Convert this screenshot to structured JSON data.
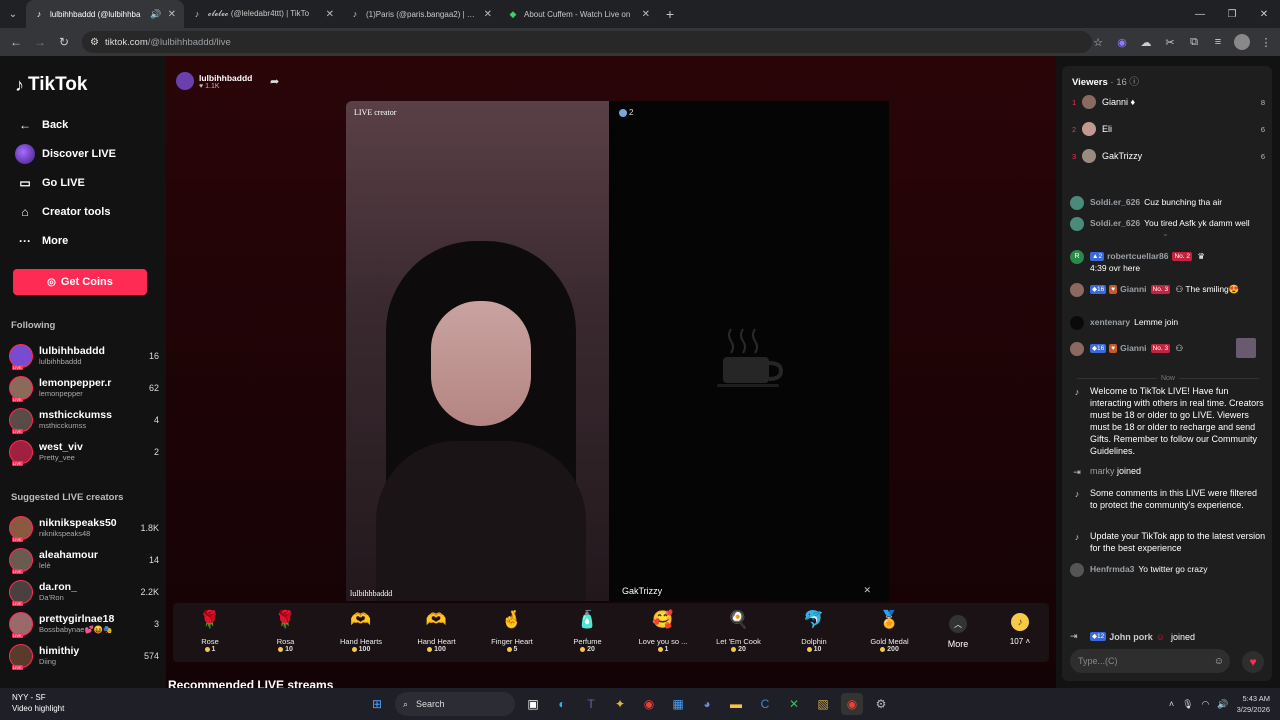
{
  "browser": {
    "tabs": [
      {
        "title": "lulbihhbaddd (@lulbihhba",
        "active": true
      },
      {
        "title": "𝓸𝓵𝓮𝓵𝓮𝓸 (@leledabr4ttt) | TikTo",
        "active": false
      },
      {
        "title": "(1)Paris (@paris.bangaa2) | TikT",
        "active": false
      },
      {
        "title": "About Cuffem - Watch Live on",
        "active": false
      }
    ],
    "url_host": "tiktok.com",
    "url_path": "/@lulbihhbaddd/live"
  },
  "sidebar": {
    "logo_text": "TikTok",
    "back_label": "Back",
    "nav": [
      {
        "label": "Discover LIVE",
        "icon": "discover-live-icon"
      },
      {
        "label": "Go LIVE",
        "icon": "video-camera-icon"
      },
      {
        "label": "Creator tools",
        "icon": "home-icon"
      },
      {
        "label": "More",
        "icon": "ellipsis-icon"
      }
    ],
    "get_coins_label": "Get Coins",
    "following_title": "Following",
    "following": [
      {
        "name": "lulbihhbaddd",
        "sub": "lulbihhbaddd",
        "count": "16",
        "color": "#7a4bd0"
      },
      {
        "name": "lemonpepper.r",
        "sub": "lemonpepper",
        "count": "62",
        "color": "#8a6a58"
      },
      {
        "name": "msthicckumss",
        "sub": "msthicckumss",
        "count": "4",
        "color": "#5a4a48"
      },
      {
        "name": "west_viv",
        "sub": "Pretty_vee",
        "count": "2",
        "color": "#a02040"
      }
    ],
    "suggested_title": "Suggested LIVE creators",
    "suggested": [
      {
        "name": "niknikspeaks50",
        "sub": "niknikspeaks48",
        "count": "1.8K",
        "color": "#8a5a40"
      },
      {
        "name": "aleahamour",
        "sub": "lelè",
        "count": "14",
        "color": "#6a5a50"
      },
      {
        "name": "da.ron_",
        "sub": "Da'Ron",
        "count": "2.2K",
        "color": "#4a4040"
      },
      {
        "name": "prettygirlnae18",
        "sub": "Bossbabynae💕😝🎭",
        "count": "3",
        "color": "#9a6a6a"
      },
      {
        "name": "himithiy",
        "sub": "Diing",
        "count": "574",
        "color": "#5a3a2a"
      }
    ]
  },
  "stream": {
    "host_name": "lulbihhbaddd",
    "host_likes": "1.1K",
    "live_creator_label": "LIVE creator",
    "host_video_name": "lulbihhbaddd",
    "guest_count": "2",
    "guest_name": "GakTrizzy",
    "recommended_title": "Recommended LIVE streams"
  },
  "gifts": [
    {
      "name": "Rose",
      "price": "1",
      "icon": "🌹"
    },
    {
      "name": "Rosa",
      "price": "10",
      "icon": "🌹"
    },
    {
      "name": "Hand Hearts",
      "price": "100",
      "icon": "🫶"
    },
    {
      "name": "Hand Heart",
      "price": "100",
      "icon": "🫶"
    },
    {
      "name": "Finger Heart",
      "price": "5",
      "icon": "🤞"
    },
    {
      "name": "Perfume",
      "price": "20",
      "icon": "🧴"
    },
    {
      "name": "Love you so ...",
      "price": "1",
      "icon": "🥰"
    },
    {
      "name": "Let 'Em Cook",
      "price": "20",
      "icon": "🍳"
    },
    {
      "name": "Dolphin",
      "price": "10",
      "icon": "🐬"
    },
    {
      "name": "Gold Medal",
      "price": "200",
      "icon": "🏅"
    }
  ],
  "gift_more_label": "More",
  "coin_balance": "107",
  "chat": {
    "viewers_label": "Viewers",
    "viewers_count": "16",
    "top_viewers": [
      {
        "rank": "1",
        "name": "Gianni ♦",
        "count": "8",
        "color": "#8a6a60"
      },
      {
        "rank": "2",
        "name": "Eli",
        "count": "6",
        "color": "#c09a90"
      },
      {
        "rank": "3",
        "name": "GakTrizzy",
        "count": "6",
        "color": "#9a8a80"
      }
    ],
    "messages": [
      {
        "user": "Soldi.er_626",
        "text": "Cuz bunching tha air"
      },
      {
        "user": "Soldi.er_626",
        "text": "You tired Asfk yk damm well"
      },
      {
        "user": "robertcuellar86",
        "text": "4:39 ovr here"
      },
      {
        "user": "Gianni",
        "text": "The smiling😍"
      },
      {
        "user": "xentenary",
        "text": "Lemme join"
      },
      {
        "user": "Gianni",
        "text": ""
      }
    ],
    "badges": {
      "lvl_2": "2",
      "lvl_16": "16",
      "no_2": "No. 2",
      "no_3": "No. 3",
      "lvl_12": "12"
    },
    "now_label": "Now",
    "welcome": "Welcome to TikTok LIVE! Have fun interacting with others in real time. Creators must be 18 or older to go LIVE. Viewers must be 18 or older to recharge and send Gifts. Remember to follow our Community Guidelines.",
    "joined_user_1": "marky",
    "joined_text": "joined",
    "filtered_notice": "Some comments in this LIVE were filtered to protect the community's experience.",
    "update_notice": "Update your TikTok app to the latest version for the best experience",
    "last_user": "Henfrmda3",
    "last_text": "Yo twitter go crazy",
    "joined_user_2": "John pork",
    "input_placeholder": "Type...(C)"
  },
  "taskbar": {
    "weather_title": "NYY - SF",
    "weather_sub": "Video highlight",
    "search_placeholder": "Search",
    "time": "5:43 AM",
    "date": "3/29/2026"
  }
}
